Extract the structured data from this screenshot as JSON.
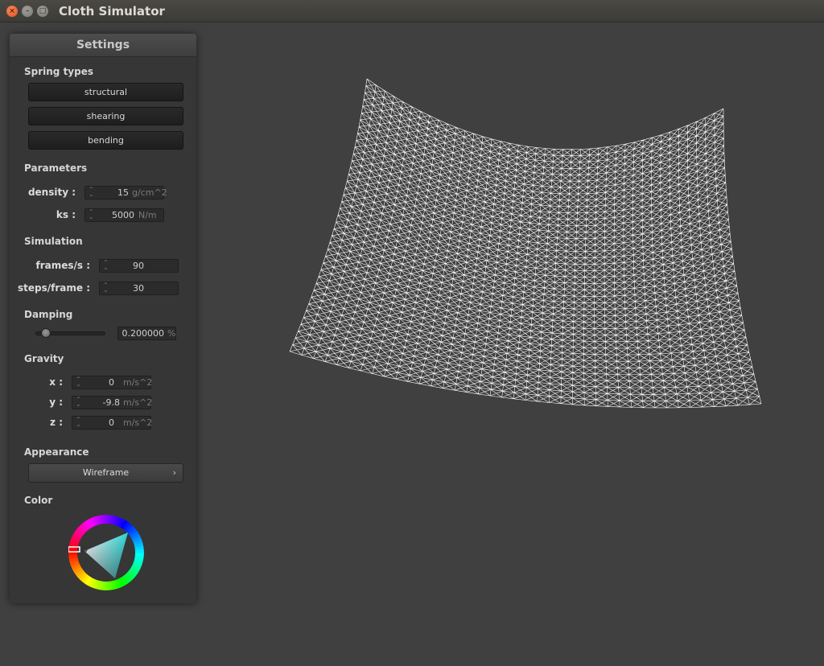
{
  "window": {
    "title": "Cloth Simulator",
    "close_glyph": "×",
    "minimize_glyph": "–",
    "maximize_glyph": "□"
  },
  "panel": {
    "title": "Settings",
    "spring_types": {
      "label": "Spring types",
      "buttons": [
        "structural",
        "shearing",
        "bending"
      ]
    },
    "parameters": {
      "label": "Parameters",
      "density": {
        "label": "density :",
        "value": "15",
        "unit": "g/cm^2"
      },
      "ks": {
        "label": "ks :",
        "value": "5000",
        "unit": "N/m"
      }
    },
    "simulation": {
      "label": "Simulation",
      "frames": {
        "label": "frames/s :",
        "value": "90"
      },
      "steps": {
        "label": "steps/frame :",
        "value": "30"
      }
    },
    "damping": {
      "label": "Damping",
      "value": "0.200000",
      "unit": "%",
      "slider_fraction": 0.2
    },
    "gravity": {
      "label": "Gravity",
      "x": {
        "label": "x :",
        "value": "0",
        "unit": "m/s^2"
      },
      "y": {
        "label": "y :",
        "value": "-9.8",
        "unit": "m/s^2"
      },
      "z": {
        "label": "z :",
        "value": "0",
        "unit": "m/s^2"
      }
    },
    "appearance": {
      "label": "Appearance",
      "selected": "Wireframe",
      "chevron": "›"
    },
    "color": {
      "label": "Color",
      "current": "#ffffff"
    }
  },
  "viewport": {
    "background": "#404040",
    "mesh_color": "#ffffff",
    "shader": "Wireframe"
  }
}
